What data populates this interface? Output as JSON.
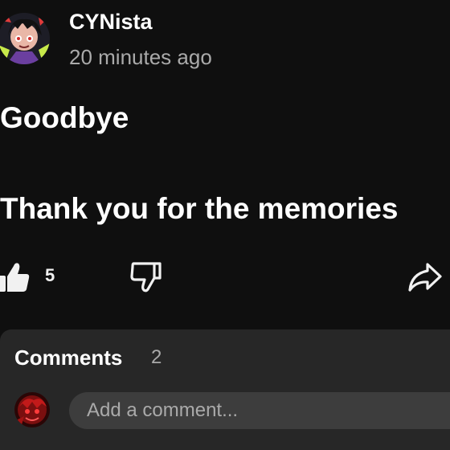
{
  "post": {
    "author": "CYNista",
    "timestamp": "20 minutes ago",
    "lines": [
      "Goodbye",
      "Thank you for the memories"
    ]
  },
  "actions": {
    "like_count": "5",
    "like_icon": "thumbs-up-icon",
    "dislike_icon": "thumbs-down-icon",
    "share_icon": "share-icon"
  },
  "comments": {
    "title": "Comments",
    "count": "2",
    "placeholder": "Add a comment..."
  },
  "colors": {
    "background": "#0f0f0f",
    "panel": "#272727",
    "input": "#3d3d3d",
    "text": "#f1f1f1",
    "secondary_text": "#aaaaaa"
  }
}
